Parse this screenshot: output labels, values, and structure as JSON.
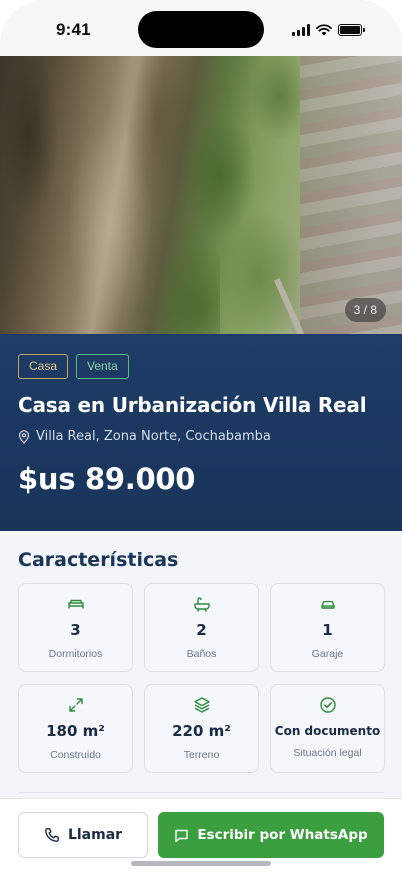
{
  "status_bar": {
    "time": "9:41",
    "icons": [
      "cellular-signal-icon",
      "wifi-icon",
      "battery-icon"
    ]
  },
  "gallery": {
    "counter": "3 / 8"
  },
  "listing": {
    "tags": {
      "type": "Casa",
      "operation": "Venta"
    },
    "title": "Casa en Urbanización Villa Real",
    "location": "Villa Real, Zona Norte, Cochabamba",
    "price": "$us 89.000"
  },
  "features": {
    "title": "Características",
    "items": [
      {
        "icon": "bed-icon",
        "value": "3",
        "label": "Dormitorios"
      },
      {
        "icon": "bathtub-icon",
        "value": "2",
        "label": "Baños"
      },
      {
        "icon": "car-icon",
        "value": "1",
        "label": "Garaje"
      },
      {
        "icon": "expand-icon",
        "value": "180 m²",
        "label": "Construido"
      },
      {
        "icon": "layers-icon",
        "value": "220 m²",
        "label": "Terreno"
      },
      {
        "icon": "check-circle-icon",
        "value": "Con documento",
        "label": "Situación legal"
      }
    ]
  },
  "actions": {
    "call_label": "Llamar",
    "whatsapp_label": "Escribir por WhatsApp"
  },
  "colors": {
    "header_bg": "#1d3c67",
    "accent_green": "#3b9e3f",
    "tag_gold": "#c9a55c",
    "tag_green": "#5fb77e",
    "icon_green": "#2f8a3a"
  }
}
